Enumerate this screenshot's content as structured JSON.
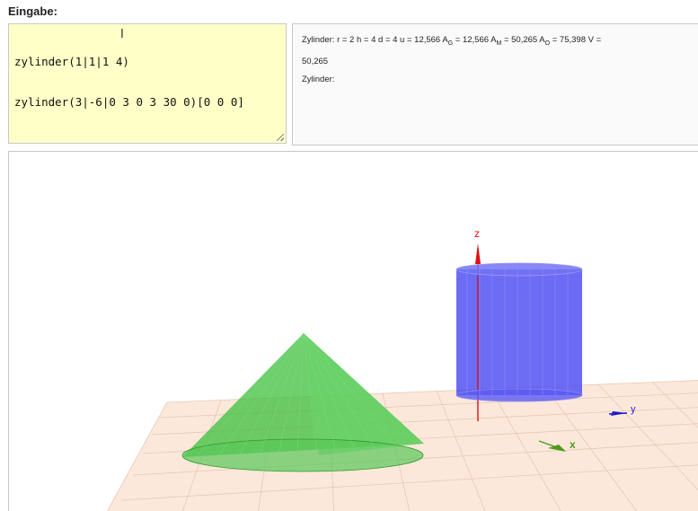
{
  "header": {
    "label": "Eingabe:"
  },
  "input": {
    "lines": [
      "zylinder(1|1|1 4)",
      "zylinder(3|-6|0 3 0 3 30 0)[0 0 0]"
    ]
  },
  "output": {
    "line1_prefix": "Zylinder: r = 2   h = 4   d = 4   u = 12,566   A",
    "ag_sub": "G",
    "ag_val": " = 12,566   A",
    "am_sub": "M",
    "am_val": " = 50,265   A",
    "ao_sub": "O",
    "ao_val": " = 75,398   V =",
    "line1_cont": "50,265",
    "line2": "Zylinder:"
  },
  "scene": {
    "axes": {
      "x_label": "x",
      "y_label": "y",
      "z_label": "z"
    },
    "colors": {
      "cylinder": "#3b3bf0",
      "cone": "#3cc03c",
      "ground": "#fce8da",
      "grid": "#e6c8b4",
      "x_axis": "#4c9a1a",
      "y_axis": "#1a1ad0",
      "z_axis": "#e01010"
    }
  }
}
